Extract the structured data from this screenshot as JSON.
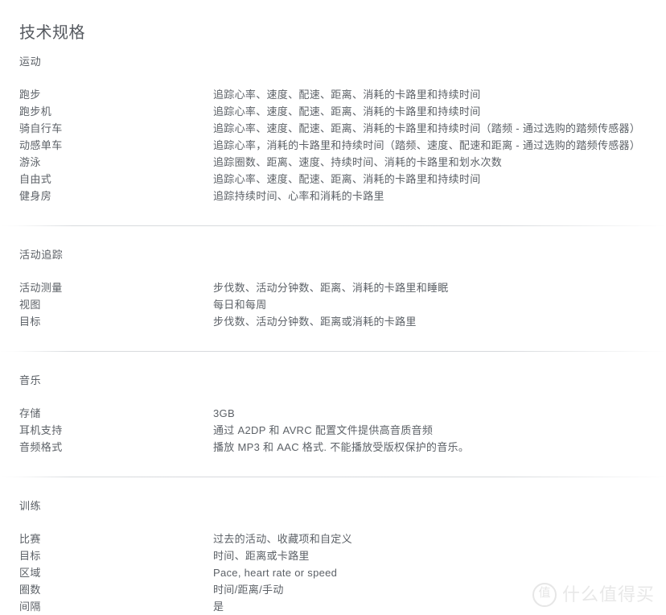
{
  "page": {
    "title": "技术规格",
    "label_column_x": 265
  },
  "sections": [
    {
      "id": "sports",
      "heading": "运动",
      "has_divider": false,
      "rows": [
        {
          "label": "跑步",
          "value": "追踪心率、速度、配速、距离、消耗的卡路里和持续时间"
        },
        {
          "label": "跑步机",
          "value": "追踪心率、速度、配速、距离、消耗的卡路里和持续时间"
        },
        {
          "label": "骑自行车",
          "value": "追踪心率、速度、配速、距离、消耗的卡路里和持续时间（踏频 - 通过选购的踏频传感器）"
        },
        {
          "label": "动感单车",
          "value": "追踪心率，消耗的卡路里和持续时间（踏频、速度、配速和距离 - 通过选购的踏频传感器）"
        },
        {
          "label": "游泳",
          "value": "追踪圈数、距离、速度、持续时间、消耗的卡路里和划水次数"
        },
        {
          "label": "自由式",
          "value": "追踪心率、速度、配速、距离、消耗的卡路里和持续时间"
        },
        {
          "label": "健身房",
          "value": "追踪持续时间、心率和消耗的卡路里"
        }
      ]
    },
    {
      "id": "activity-tracking",
      "heading": "活动追踪",
      "has_divider": true,
      "rows": [
        {
          "label": "活动测量",
          "value": "步伐数、活动分钟数、距离、消耗的卡路里和睡眠"
        },
        {
          "label": "视图",
          "value": "每日和每周"
        },
        {
          "label": "目标",
          "value": "步伐数、活动分钟数、距离或消耗的卡路里"
        }
      ]
    },
    {
      "id": "music",
      "heading": "音乐",
      "has_divider": true,
      "rows": [
        {
          "label": "存储",
          "value": "3GB"
        },
        {
          "label": "耳机支持",
          "value": "通过 A2DP 和 AVRC 配置文件提供高音质音频"
        },
        {
          "label": "音频格式",
          "value": "播放 MP3 和 AAC 格式. 不能播放受版权保护的音乐。"
        }
      ]
    },
    {
      "id": "training",
      "heading": "训练",
      "has_divider": true,
      "rows": [
        {
          "label": "比赛",
          "value": "过去的活动、收藏项和自定义"
        },
        {
          "label": "目标",
          "value": "时间、距离或卡路里"
        },
        {
          "label": "区域",
          "value": "Pace, heart rate or speed"
        },
        {
          "label": "圈数",
          "value": "时间/距离/手动"
        },
        {
          "label": "间隔",
          "value": "是"
        }
      ]
    }
  ],
  "watermark": {
    "mark": "值",
    "text": "什么值得买"
  },
  "colors": {
    "text": "#5c6167",
    "title": "#55595f",
    "divider": "#d6d9dc",
    "watermark": "#e8e8e8",
    "background": "#ffffff"
  }
}
